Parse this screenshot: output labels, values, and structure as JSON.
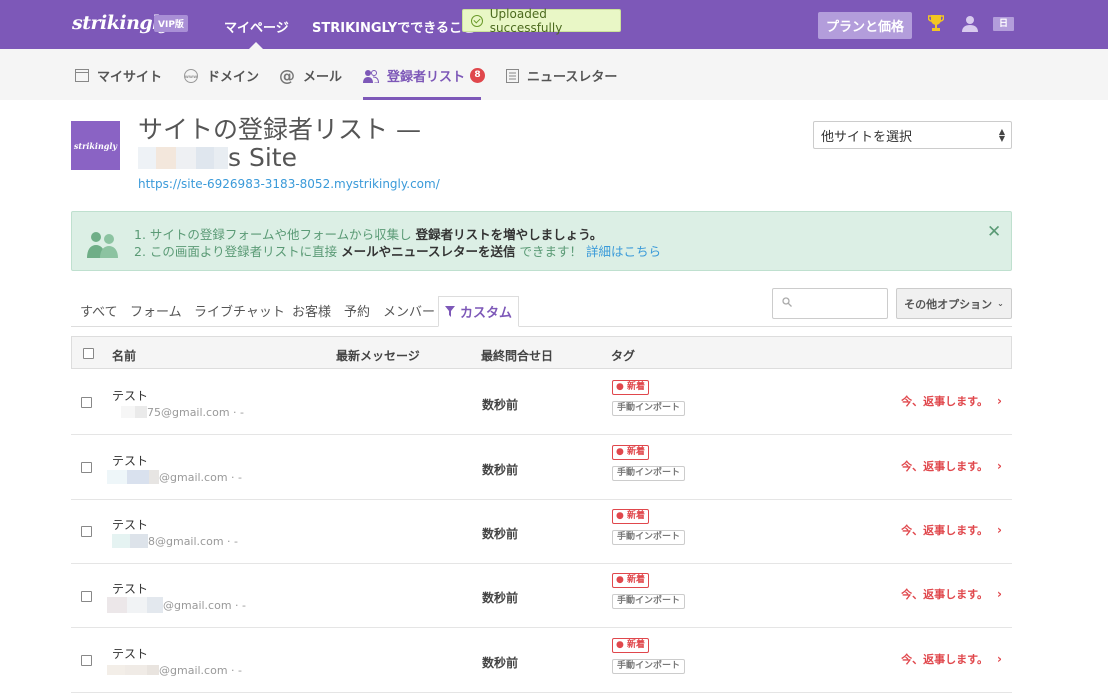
{
  "topbar": {
    "logo": "strikingly",
    "vip": "VIP版",
    "nav_mypage": "マイページ",
    "nav_features": "STRIKINGLYでできること",
    "toast": "Uploaded successfully",
    "plan_button": "プランと価格",
    "lang": "日"
  },
  "subnav": {
    "items": [
      {
        "label": "マイサイト",
        "icon": "browser-icon"
      },
      {
        "label": "ドメイン",
        "icon": "www-icon"
      },
      {
        "label": "メール",
        "icon": "at-icon"
      },
      {
        "label": "登録者リスト",
        "icon": "users-icon",
        "badge": "8"
      },
      {
        "label": "ニュースレター",
        "icon": "newsletter-icon"
      }
    ]
  },
  "site": {
    "thumb_text": "strikingly",
    "title_line1": "サイトの登録者リスト —",
    "title_suffix": "s Site",
    "url": "https://site-6926983-3183-8052.mystrikingly.com/",
    "select_label": "他サイトを選択"
  },
  "info": {
    "line1_pre": "1. サイトの登録フォームや他フォームから収集し",
    "line1_bold": "登録者リストを増やしましょう。",
    "line2_pre": "2. この画面より登録者リストに直接",
    "line2_bold": "メールやニュースレターを送信",
    "line2_mid": "できます！",
    "line2_link": "詳細はこちら"
  },
  "filters": {
    "tabs": [
      "すべて",
      "フォーム",
      "ライブチャット",
      "お客様",
      "予約",
      "メンバー"
    ],
    "active": "カスタム",
    "more_options": "その他オプション"
  },
  "table": {
    "headers": {
      "name": "名前",
      "message": "最新メッセージ",
      "date": "最終問合せ日",
      "tags": "タグ"
    },
    "rows": [
      {
        "name": "テスト",
        "email": "75@gmail.com · -",
        "date": "数秒前",
        "tag_new": "● 新着",
        "tag_import": "手動インポート",
        "reply": "今、返事します。"
      },
      {
        "name": "テスト",
        "email": "@gmail.com · -",
        "date": "数秒前",
        "tag_new": "● 新着",
        "tag_import": "手動インポート",
        "reply": "今、返事します。"
      },
      {
        "name": "テスト",
        "email": "8@gmail.com · -",
        "date": "数秒前",
        "tag_new": "● 新着",
        "tag_import": "手動インポート",
        "reply": "今、返事します。"
      },
      {
        "name": "テスト",
        "email": "@gmail.com · -",
        "date": "数秒前",
        "tag_new": "● 新着",
        "tag_import": "手動インポート",
        "reply": "今、返事します。"
      },
      {
        "name": "テスト",
        "email": "@gmail.com · -",
        "date": "数秒前",
        "tag_new": "● 新着",
        "tag_import": "手動インポート",
        "reply": "今、返事します。"
      }
    ]
  },
  "colors": {
    "brand": "#7d58b8",
    "alert_red": "#e0474c",
    "link": "#3a9ad9",
    "info_bg": "#dcefe5"
  }
}
